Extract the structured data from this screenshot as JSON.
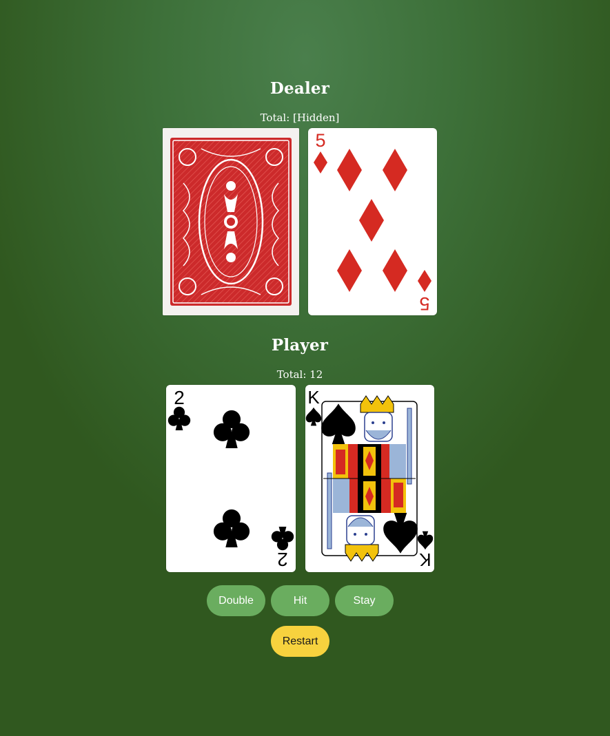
{
  "dealer": {
    "heading": "Dealer",
    "total_label": "Total: [Hidden]",
    "cards": [
      {
        "face": "back",
        "design": "red-ornate-back"
      },
      {
        "rank": "5",
        "suit": "diamonds",
        "suit_symbol": "♦",
        "color": "#d52a22"
      }
    ]
  },
  "player": {
    "heading": "Player",
    "total_label": "Total: 12",
    "cards": [
      {
        "rank": "2",
        "suit": "clubs",
        "suit_symbol": "♣",
        "color": "#000000"
      },
      {
        "rank": "K",
        "suit": "spades",
        "suit_symbol": "♠",
        "color": "#000000"
      }
    ]
  },
  "actions": {
    "double_label": "Double",
    "hit_label": "Hit",
    "stay_label": "Stay",
    "restart_label": "Restart"
  },
  "colors": {
    "table_green": "#3d7039",
    "button_green": "#6aad5f",
    "button_yellow": "#f7d23e",
    "card_red": "#d52a22",
    "card_back_red": "#cc2a2b"
  }
}
